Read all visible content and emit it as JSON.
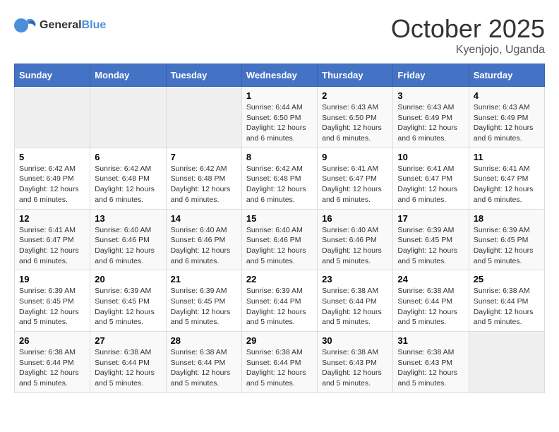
{
  "header": {
    "logo_general": "General",
    "logo_blue": "Blue",
    "month": "October 2025",
    "location": "Kyenjojo, Uganda"
  },
  "weekdays": [
    "Sunday",
    "Monday",
    "Tuesday",
    "Wednesday",
    "Thursday",
    "Friday",
    "Saturday"
  ],
  "weeks": [
    [
      {
        "day": "",
        "info": ""
      },
      {
        "day": "",
        "info": ""
      },
      {
        "day": "",
        "info": ""
      },
      {
        "day": "1",
        "info": "Sunrise: 6:44 AM\nSunset: 6:50 PM\nDaylight: 12 hours\nand 6 minutes."
      },
      {
        "day": "2",
        "info": "Sunrise: 6:43 AM\nSunset: 6:50 PM\nDaylight: 12 hours\nand 6 minutes."
      },
      {
        "day": "3",
        "info": "Sunrise: 6:43 AM\nSunset: 6:49 PM\nDaylight: 12 hours\nand 6 minutes."
      },
      {
        "day": "4",
        "info": "Sunrise: 6:43 AM\nSunset: 6:49 PM\nDaylight: 12 hours\nand 6 minutes."
      }
    ],
    [
      {
        "day": "5",
        "info": "Sunrise: 6:42 AM\nSunset: 6:49 PM\nDaylight: 12 hours\nand 6 minutes."
      },
      {
        "day": "6",
        "info": "Sunrise: 6:42 AM\nSunset: 6:48 PM\nDaylight: 12 hours\nand 6 minutes."
      },
      {
        "day": "7",
        "info": "Sunrise: 6:42 AM\nSunset: 6:48 PM\nDaylight: 12 hours\nand 6 minutes."
      },
      {
        "day": "8",
        "info": "Sunrise: 6:42 AM\nSunset: 6:48 PM\nDaylight: 12 hours\nand 6 minutes."
      },
      {
        "day": "9",
        "info": "Sunrise: 6:41 AM\nSunset: 6:47 PM\nDaylight: 12 hours\nand 6 minutes."
      },
      {
        "day": "10",
        "info": "Sunrise: 6:41 AM\nSunset: 6:47 PM\nDaylight: 12 hours\nand 6 minutes."
      },
      {
        "day": "11",
        "info": "Sunrise: 6:41 AM\nSunset: 6:47 PM\nDaylight: 12 hours\nand 6 minutes."
      }
    ],
    [
      {
        "day": "12",
        "info": "Sunrise: 6:41 AM\nSunset: 6:47 PM\nDaylight: 12 hours\nand 6 minutes."
      },
      {
        "day": "13",
        "info": "Sunrise: 6:40 AM\nSunset: 6:46 PM\nDaylight: 12 hours\nand 6 minutes."
      },
      {
        "day": "14",
        "info": "Sunrise: 6:40 AM\nSunset: 6:46 PM\nDaylight: 12 hours\nand 6 minutes."
      },
      {
        "day": "15",
        "info": "Sunrise: 6:40 AM\nSunset: 6:46 PM\nDaylight: 12 hours\nand 5 minutes."
      },
      {
        "day": "16",
        "info": "Sunrise: 6:40 AM\nSunset: 6:46 PM\nDaylight: 12 hours\nand 5 minutes."
      },
      {
        "day": "17",
        "info": "Sunrise: 6:39 AM\nSunset: 6:45 PM\nDaylight: 12 hours\nand 5 minutes."
      },
      {
        "day": "18",
        "info": "Sunrise: 6:39 AM\nSunset: 6:45 PM\nDaylight: 12 hours\nand 5 minutes."
      }
    ],
    [
      {
        "day": "19",
        "info": "Sunrise: 6:39 AM\nSunset: 6:45 PM\nDaylight: 12 hours\nand 5 minutes."
      },
      {
        "day": "20",
        "info": "Sunrise: 6:39 AM\nSunset: 6:45 PM\nDaylight: 12 hours\nand 5 minutes."
      },
      {
        "day": "21",
        "info": "Sunrise: 6:39 AM\nSunset: 6:45 PM\nDaylight: 12 hours\nand 5 minutes."
      },
      {
        "day": "22",
        "info": "Sunrise: 6:39 AM\nSunset: 6:44 PM\nDaylight: 12 hours\nand 5 minutes."
      },
      {
        "day": "23",
        "info": "Sunrise: 6:38 AM\nSunset: 6:44 PM\nDaylight: 12 hours\nand 5 minutes."
      },
      {
        "day": "24",
        "info": "Sunrise: 6:38 AM\nSunset: 6:44 PM\nDaylight: 12 hours\nand 5 minutes."
      },
      {
        "day": "25",
        "info": "Sunrise: 6:38 AM\nSunset: 6:44 PM\nDaylight: 12 hours\nand 5 minutes."
      }
    ],
    [
      {
        "day": "26",
        "info": "Sunrise: 6:38 AM\nSunset: 6:44 PM\nDaylight: 12 hours\nand 5 minutes."
      },
      {
        "day": "27",
        "info": "Sunrise: 6:38 AM\nSunset: 6:44 PM\nDaylight: 12 hours\nand 5 minutes."
      },
      {
        "day": "28",
        "info": "Sunrise: 6:38 AM\nSunset: 6:44 PM\nDaylight: 12 hours\nand 5 minutes."
      },
      {
        "day": "29",
        "info": "Sunrise: 6:38 AM\nSunset: 6:44 PM\nDaylight: 12 hours\nand 5 minutes."
      },
      {
        "day": "30",
        "info": "Sunrise: 6:38 AM\nSunset: 6:43 PM\nDaylight: 12 hours\nand 5 minutes."
      },
      {
        "day": "31",
        "info": "Sunrise: 6:38 AM\nSunset: 6:43 PM\nDaylight: 12 hours\nand 5 minutes."
      },
      {
        "day": "",
        "info": ""
      }
    ]
  ]
}
